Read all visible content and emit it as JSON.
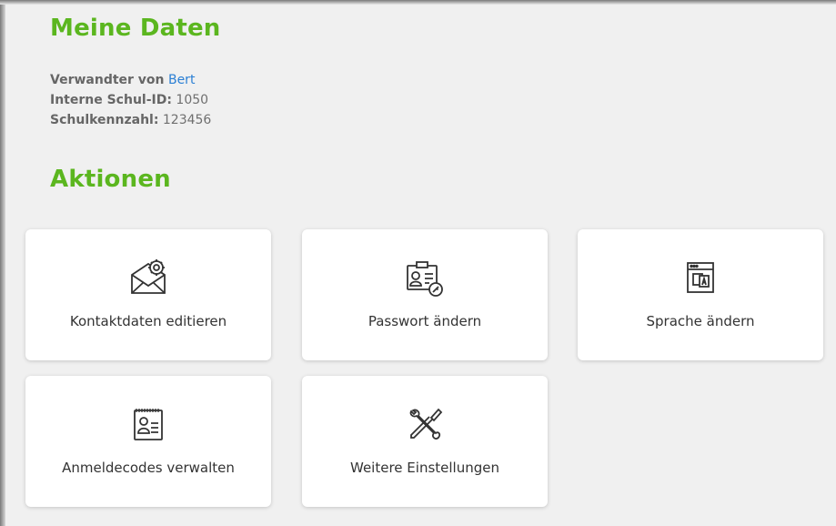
{
  "meine_daten": {
    "title": "Meine Daten",
    "verwandter_label": "Verwandter von",
    "verwandter_name": "Bert",
    "schul_id_label": "Interne Schul-ID:",
    "schul_id_value": "1050",
    "schulkennzahl_label": "Schulkennzahl:",
    "schulkennzahl_value": "123456"
  },
  "aktionen": {
    "title": "Aktionen",
    "cards": [
      {
        "label": "Kontaktdaten editieren",
        "icon": "envelope-gear-icon"
      },
      {
        "label": "Passwort ändern",
        "icon": "id-card-key-icon"
      },
      {
        "label": "Sprache ändern",
        "icon": "browser-translate-icon"
      },
      {
        "label": "Anmeldecodes verwalten",
        "icon": "contact-notepad-icon"
      },
      {
        "label": "Weitere Einstellungen",
        "icon": "wrench-screwdriver-icon"
      }
    ]
  },
  "colors": {
    "accent": "#5bb61f",
    "link": "#2a7fd4"
  }
}
